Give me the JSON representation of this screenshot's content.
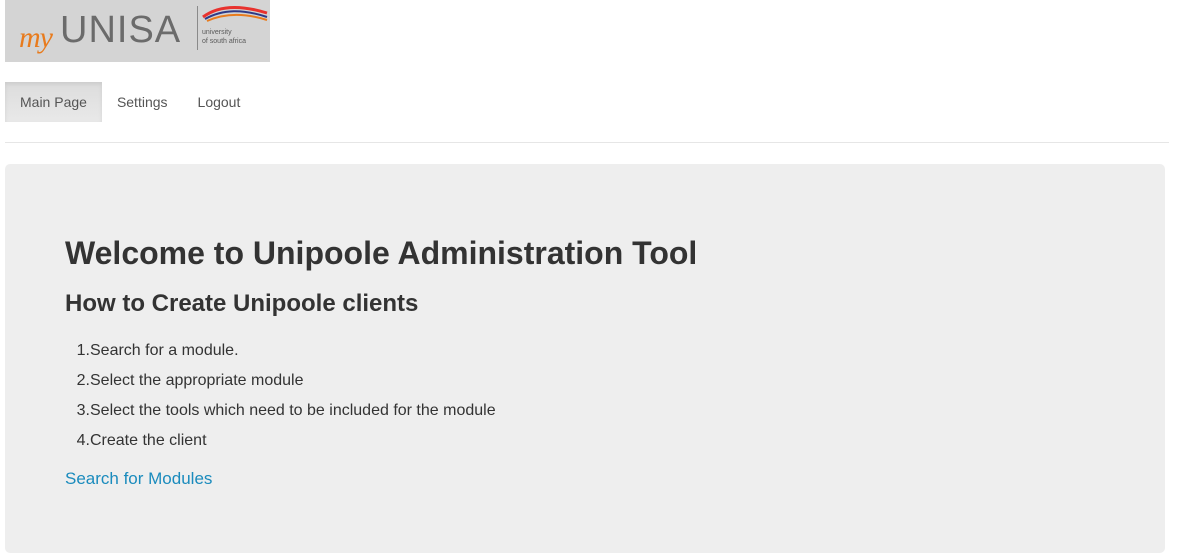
{
  "logo": {
    "my": "my",
    "brand": "UNISA",
    "tagline": "university\nof south africa",
    "swoosh_colors": [
      "#e8322e",
      "#2e3a87",
      "#e87b1d"
    ]
  },
  "nav": {
    "items": [
      {
        "label": "Main Page",
        "active": true
      },
      {
        "label": "Settings",
        "active": false
      },
      {
        "label": "Logout",
        "active": false
      }
    ]
  },
  "main": {
    "title": "Welcome to Unipoole Administration Tool",
    "subtitle": "How to Create Unipoole clients",
    "steps": [
      {
        "num": "1",
        "text": "Search for a module."
      },
      {
        "num": "2",
        "text": "Select the appropriate module"
      },
      {
        "num": "3",
        "text": "Select the tools which need to be included for the module"
      },
      {
        "num": "4",
        "text": "Create the client"
      }
    ],
    "link_label": "Search for Modules"
  },
  "colors": {
    "link": "#1a8bbd",
    "panel_bg": "#eeeeee",
    "logo_bg": "#d4d4d4",
    "accent_orange": "#e87b1d"
  }
}
